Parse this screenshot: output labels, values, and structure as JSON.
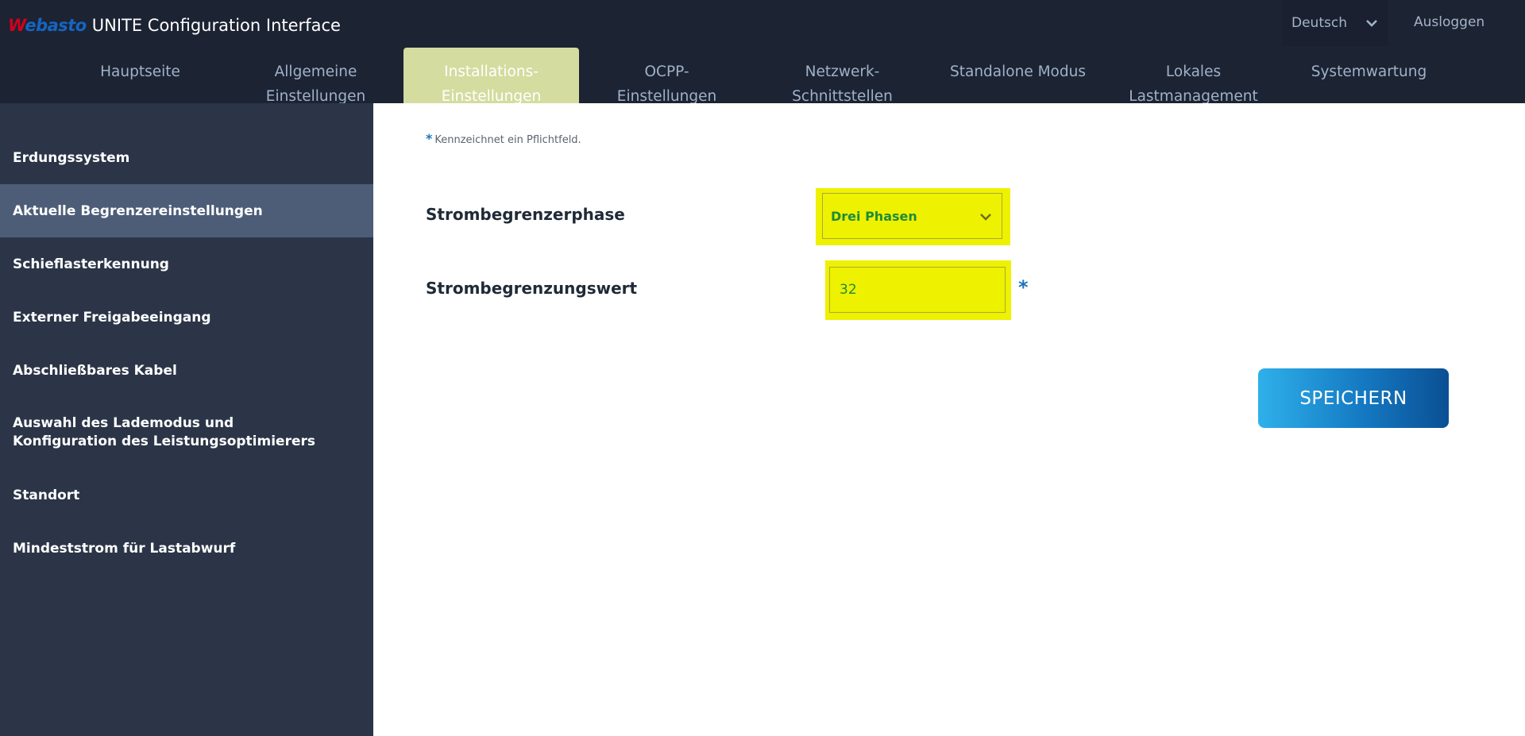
{
  "header": {
    "logo_text": "Webasto",
    "app_title": "UNITE Configuration Interface",
    "language": "Deutsch",
    "logout_label": "Ausloggen"
  },
  "nav": {
    "tabs": [
      {
        "label": "Hauptseite",
        "active": false
      },
      {
        "label": "Allgemeine Einstellungen",
        "active": false
      },
      {
        "label": "Installations-Einstellungen",
        "active": true
      },
      {
        "label": "OCPP-Einstellungen",
        "active": false
      },
      {
        "label": "Netzwerk-Schnittstellen",
        "active": false
      },
      {
        "label": "Standalone Modus",
        "active": false
      },
      {
        "label": "Lokales Lastmanagement",
        "active": false
      },
      {
        "label": "Systemwartung",
        "active": false
      }
    ]
  },
  "sidebar": {
    "items": [
      {
        "label": "Erdungssystem",
        "active": false
      },
      {
        "label": "Aktuelle Begrenzereinstellungen",
        "active": true
      },
      {
        "label": "Schieflasterkennung",
        "active": false
      },
      {
        "label": "Externer Freigabeeingang",
        "active": false
      },
      {
        "label": "Abschließbares Kabel",
        "active": false
      },
      {
        "label": "Auswahl des Lademodus und Konfiguration des Leistungsoptimierers",
        "active": false
      },
      {
        "label": "Standort",
        "active": false
      },
      {
        "label": "Mindeststrom für Lastabwurf",
        "active": false
      }
    ]
  },
  "main": {
    "required_note_star": "*",
    "required_note": "Kennzeichnet ein Pflichtfeld.",
    "phase_label": "Strombegrenzerphase",
    "phase_value": "Drei Phasen",
    "limit_label": "Strombegrenzungswert",
    "limit_value": "32",
    "limit_required_star": "*",
    "save_label": "SPEICHERN"
  },
  "colors": {
    "header_bg": "#1c2333",
    "active_tab": "#d4dc9f",
    "sidebar_bg": "#2b3547",
    "sidebar_active": "#4d5d78",
    "highlight": "#eef100",
    "accent_blue": "#1e73be"
  }
}
